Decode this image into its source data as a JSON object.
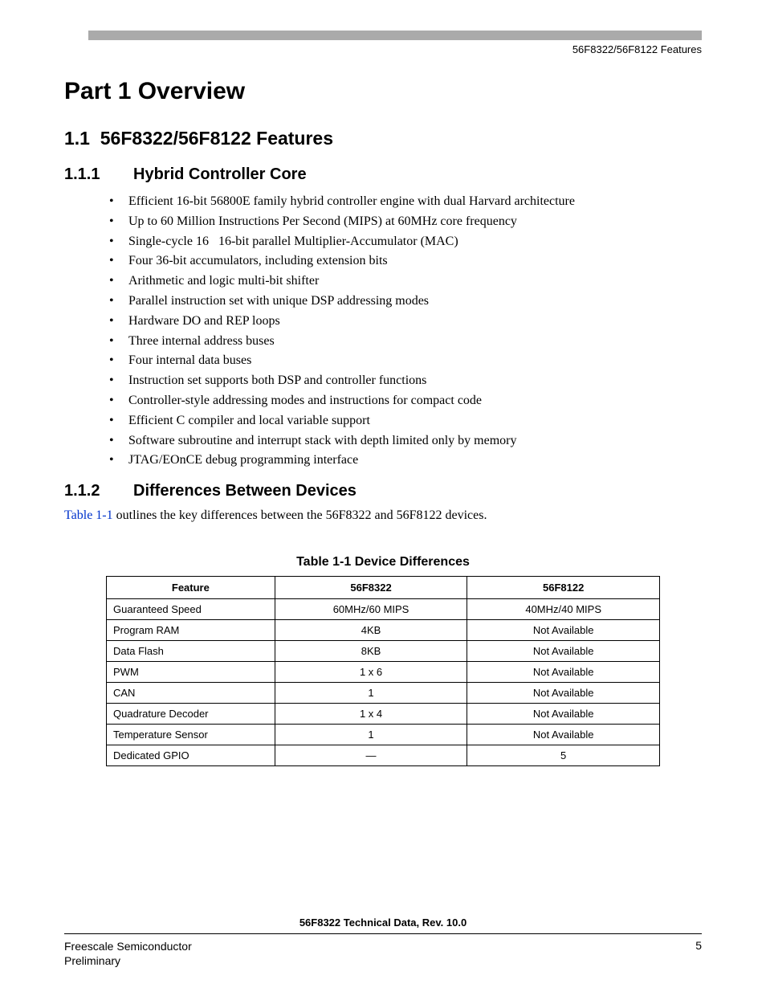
{
  "header": {
    "label": "56F8322/56F8122 Features"
  },
  "part": {
    "title": "Part 1  Overview"
  },
  "section": {
    "number": "1.1",
    "title": "56F8322/56F8122 Features"
  },
  "sub1": {
    "number": "1.1.1",
    "title": "Hybrid Controller Core",
    "bullets": [
      "Efficient 16-bit 56800E family hybrid controller engine with dual Harvard architecture",
      "Up to 60 Million Instructions Per Second (MIPS) at 60MHz core frequency",
      "Single-cycle 16   16-bit parallel Multiplier-Accumulator (MAC)",
      "Four 36-bit accumulators, including extension bits",
      "Arithmetic and logic multi-bit shifter",
      "Parallel instruction set with unique DSP addressing modes",
      "Hardware DO and REP loops",
      "Three internal address buses",
      "Four internal data buses",
      "Instruction set supports both DSP and controller functions",
      "Controller-style addressing modes and instructions for compact code",
      "Efficient C compiler and local variable support",
      "Software subroutine and interrupt stack with depth limited only by memory",
      "JTAG/EOnCE debug programming interface"
    ]
  },
  "sub2": {
    "number": "1.1.2",
    "title": "Differences Between Devices",
    "para_link": "Table 1-1",
    "para_rest": " outlines the key differences between the 56F8322 and 56F8122 devices."
  },
  "table": {
    "caption": "Table 1-1 Device Differences",
    "headers": [
      "Feature",
      "56F8322",
      "56F8122"
    ],
    "rows": [
      [
        "Guaranteed Speed",
        "60MHz/60 MIPS",
        "40MHz/40 MIPS"
      ],
      [
        "Program RAM",
        "4KB",
        "Not Available"
      ],
      [
        "Data Flash",
        "8KB",
        "Not Available"
      ],
      [
        "PWM",
        "1 x 6",
        "Not Available"
      ],
      [
        "CAN",
        "1",
        "Not Available"
      ],
      [
        "Quadrature Decoder",
        "1 x 4",
        "Not Available"
      ],
      [
        "Temperature Sensor",
        "1",
        "Not Available"
      ],
      [
        "Dedicated GPIO",
        "—",
        "5"
      ]
    ]
  },
  "footer": {
    "doc": "56F8322 Technical Data, Rev. 10.0",
    "company": "Freescale Semiconductor",
    "status": "Preliminary",
    "page": "5"
  }
}
